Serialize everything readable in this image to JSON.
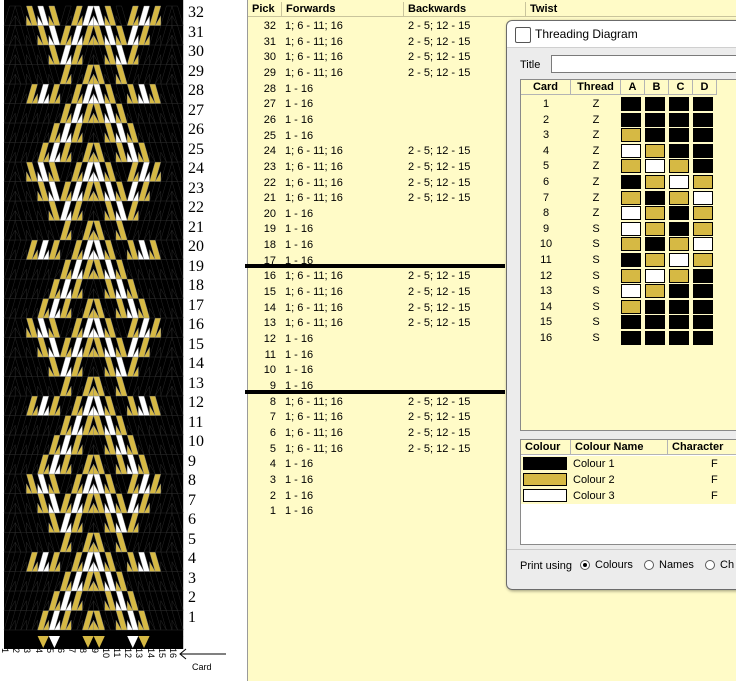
{
  "pattern": {
    "pick_numbers": [
      "32",
      "31",
      "30",
      "29",
      "28",
      "27",
      "26",
      "25",
      "24",
      "23",
      "22",
      "21",
      "20",
      "19",
      "18",
      "17",
      "16",
      "15",
      "14",
      "13",
      "12",
      "11",
      "10",
      "9",
      "8",
      "7",
      "6",
      "5",
      "4",
      "3",
      "2",
      "1"
    ],
    "card_numbers": [
      "1",
      "2",
      "3",
      "4",
      "5",
      "6",
      "7",
      "8",
      "9",
      "10",
      "11",
      "12",
      "13",
      "14",
      "15",
      "16"
    ],
    "card_axis_label": "Card",
    "colors": {
      "black": "#000000",
      "gold": "#d6b944",
      "white": "#ffffff"
    }
  },
  "table": {
    "headers": {
      "pick": "Pick",
      "forwards": "Forwards",
      "backwards": "Backwards",
      "twist": "Twist"
    },
    "rows": [
      {
        "pick": "32",
        "fw": "1; 6 - 11; 16",
        "bw": "2 - 5; 12 - 15"
      },
      {
        "pick": "31",
        "fw": "1; 6 - 11; 16",
        "bw": "2 - 5; 12 - 15"
      },
      {
        "pick": "30",
        "fw": "1; 6 - 11; 16",
        "bw": "2 - 5; 12 - 15"
      },
      {
        "pick": "29",
        "fw": "1; 6 - 11; 16",
        "bw": "2 - 5; 12 - 15"
      },
      {
        "pick": "28",
        "fw": "1 - 16",
        "bw": ""
      },
      {
        "pick": "27",
        "fw": "1 - 16",
        "bw": ""
      },
      {
        "pick": "26",
        "fw": "1 - 16",
        "bw": ""
      },
      {
        "pick": "25",
        "fw": "1 - 16",
        "bw": ""
      },
      {
        "pick": "24",
        "fw": "1; 6 - 11; 16",
        "bw": "2 - 5; 12 - 15"
      },
      {
        "pick": "23",
        "fw": "1; 6 - 11; 16",
        "bw": "2 - 5; 12 - 15"
      },
      {
        "pick": "22",
        "fw": "1; 6 - 11; 16",
        "bw": "2 - 5; 12 - 15"
      },
      {
        "pick": "21",
        "fw": "1; 6 - 11; 16",
        "bw": "2 - 5; 12 - 15"
      },
      {
        "pick": "20",
        "fw": "1 - 16",
        "bw": ""
      },
      {
        "pick": "19",
        "fw": "1 - 16",
        "bw": ""
      },
      {
        "pick": "18",
        "fw": "1 - 16",
        "bw": ""
      },
      {
        "pick": "17",
        "fw": "1 - 16",
        "bw": ""
      },
      {
        "pick": "16",
        "fw": "1; 6 - 11; 16",
        "bw": "2 - 5; 12 - 15"
      },
      {
        "pick": "15",
        "fw": "1; 6 - 11; 16",
        "bw": "2 - 5; 12 - 15"
      },
      {
        "pick": "14",
        "fw": "1; 6 - 11; 16",
        "bw": "2 - 5; 12 - 15"
      },
      {
        "pick": "13",
        "fw": "1; 6 - 11; 16",
        "bw": "2 - 5; 12 - 15"
      },
      {
        "pick": "12",
        "fw": "1 - 16",
        "bw": ""
      },
      {
        "pick": "11",
        "fw": "1 - 16",
        "bw": ""
      },
      {
        "pick": "10",
        "fw": "1 - 16",
        "bw": ""
      },
      {
        "pick": "9",
        "fw": "1 - 16",
        "bw": ""
      },
      {
        "pick": "8",
        "fw": "1; 6 - 11; 16",
        "bw": "2 - 5; 12 - 15"
      },
      {
        "pick": "7",
        "fw": "1; 6 - 11; 16",
        "bw": "2 - 5; 12 - 15"
      },
      {
        "pick": "6",
        "fw": "1; 6 - 11; 16",
        "bw": "2 - 5; 12 - 15"
      },
      {
        "pick": "5",
        "fw": "1; 6 - 11; 16",
        "bw": "2 - 5; 12 - 15"
      },
      {
        "pick": "4",
        "fw": "1 - 16",
        "bw": ""
      },
      {
        "pick": "3",
        "fw": "1 - 16",
        "bw": ""
      },
      {
        "pick": "2",
        "fw": "1 - 16",
        "bw": ""
      },
      {
        "pick": "1",
        "fw": "1 - 16",
        "bw": ""
      }
    ]
  },
  "dialog": {
    "title": "Threading Diagram",
    "title_label": "Title",
    "title_value": "",
    "card_headers": {
      "card": "Card",
      "thread": "Thread",
      "a": "A",
      "b": "B",
      "c": "C",
      "d": "D"
    },
    "cards": [
      {
        "card": "1",
        "thread": "Z",
        "holes": [
          "black",
          "black",
          "black",
          "black"
        ]
      },
      {
        "card": "2",
        "thread": "Z",
        "holes": [
          "black",
          "black",
          "black",
          "black"
        ]
      },
      {
        "card": "3",
        "thread": "Z",
        "holes": [
          "gold",
          "black",
          "black",
          "black"
        ]
      },
      {
        "card": "4",
        "thread": "Z",
        "holes": [
          "white",
          "gold",
          "black",
          "black"
        ]
      },
      {
        "card": "5",
        "thread": "Z",
        "holes": [
          "gold",
          "white",
          "gold",
          "black"
        ]
      },
      {
        "card": "6",
        "thread": "Z",
        "holes": [
          "black",
          "gold",
          "white",
          "gold"
        ]
      },
      {
        "card": "7",
        "thread": "Z",
        "holes": [
          "gold",
          "black",
          "gold",
          "white"
        ]
      },
      {
        "card": "8",
        "thread": "Z",
        "holes": [
          "white",
          "gold",
          "black",
          "gold"
        ]
      },
      {
        "card": "9",
        "thread": "S",
        "holes": [
          "white",
          "gold",
          "black",
          "gold"
        ]
      },
      {
        "card": "10",
        "thread": "S",
        "holes": [
          "gold",
          "black",
          "gold",
          "white"
        ]
      },
      {
        "card": "11",
        "thread": "S",
        "holes": [
          "black",
          "gold",
          "white",
          "gold"
        ]
      },
      {
        "card": "12",
        "thread": "S",
        "holes": [
          "gold",
          "white",
          "gold",
          "black"
        ]
      },
      {
        "card": "13",
        "thread": "S",
        "holes": [
          "white",
          "gold",
          "black",
          "black"
        ]
      },
      {
        "card": "14",
        "thread": "S",
        "holes": [
          "gold",
          "black",
          "black",
          "black"
        ]
      },
      {
        "card": "15",
        "thread": "S",
        "holes": [
          "black",
          "black",
          "black",
          "black"
        ]
      },
      {
        "card": "16",
        "thread": "S",
        "holes": [
          "black",
          "black",
          "black",
          "black"
        ]
      }
    ],
    "colour_headers": {
      "colour": "Colour",
      "name": "Colour Name",
      "character": "Character"
    },
    "colours": [
      {
        "swatch": "#000000",
        "name": "Colour 1",
        "char": "F"
      },
      {
        "swatch": "#d6b944",
        "name": "Colour 2",
        "char": "F"
      },
      {
        "swatch": "#ffffff",
        "name": "Colour 3",
        "char": "F"
      }
    ],
    "print_label": "Print using",
    "print_options": [
      {
        "label": "Colours",
        "selected": true
      },
      {
        "label": "Names",
        "selected": false
      },
      {
        "label": "Ch",
        "selected": false
      }
    ]
  }
}
